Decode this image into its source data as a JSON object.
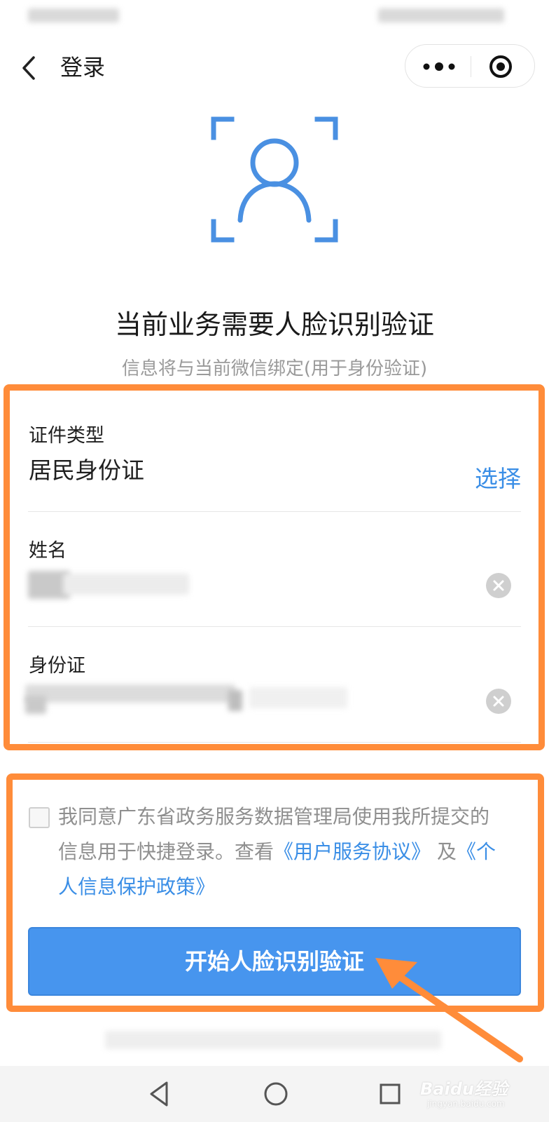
{
  "header": {
    "title": "登录",
    "back_icon": "chevron-left-icon",
    "more_icon": "more-dots-icon",
    "close_icon": "target-circle-icon"
  },
  "hero": {
    "icon": "face-scan-icon",
    "headline": "当前业务需要人脸识别验证",
    "subline": "信息将与当前微信绑定(用于身份验证)"
  },
  "form": {
    "id_type": {
      "label": "证件类型",
      "value": "居民身份证",
      "action": "选择"
    },
    "name": {
      "label": "姓名"
    },
    "id_number": {
      "label": "身份证"
    }
  },
  "agreement": {
    "text_1": "我同意广东省政务服务数据管理局使用我所提交的信息用于快捷登录。查看",
    "link_1": "《用户服务协议》",
    "text_2": "及",
    "link_2": "《个人信息保护政策》"
  },
  "start_button": {
    "label": "开始人脸识别验证"
  },
  "colors": {
    "accent": "#4795ee",
    "link": "#3a8ee6",
    "highlight": "#ff8c3a"
  },
  "watermark": {
    "brand": "Baidu经验",
    "site": "jingyan.baidu.com"
  }
}
